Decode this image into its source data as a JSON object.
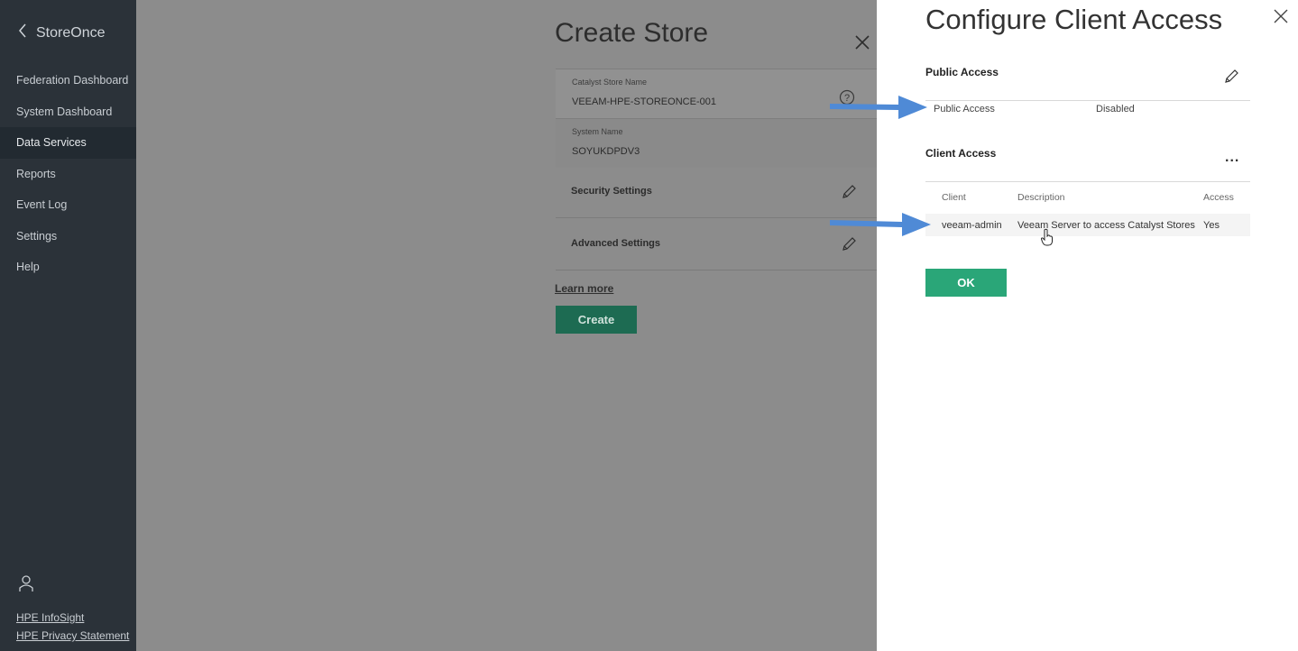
{
  "sidebar": {
    "brand": "StoreOnce",
    "items": [
      {
        "label": "Federation Dashboard"
      },
      {
        "label": "System Dashboard"
      },
      {
        "label": "Data Services"
      },
      {
        "label": "Reports"
      },
      {
        "label": "Event Log"
      },
      {
        "label": "Settings"
      },
      {
        "label": "Help"
      }
    ],
    "active_item": "Data Services",
    "footer_links": [
      "HPE InfoSight",
      "HPE Privacy Statement"
    ]
  },
  "create_store": {
    "title": "Create Store",
    "fields": [
      {
        "label": "Catalyst Store Name",
        "value": "VEEAM-HPE-STOREONCE-001"
      },
      {
        "label": "System Name",
        "value": "SOYUKDPDV3"
      }
    ],
    "settings": [
      "Security Settings",
      "Advanced Settings"
    ],
    "learn_more": "Learn more",
    "create_label": "Create"
  },
  "client_access": {
    "title": "Configure Client Access",
    "public_section": "Public Access",
    "public_row": {
      "label": "Public Access",
      "value": "Disabled"
    },
    "client_section": "Client Access",
    "columns": [
      "Client",
      "Description",
      "Access"
    ],
    "rows": [
      {
        "client": "veeam-admin",
        "description": "Veeam Server to access Catalyst Stores",
        "access": "Yes"
      }
    ],
    "more_label": "...",
    "ok_label": "OK"
  },
  "colors": {
    "sidebar_bg": "#2b3239",
    "ok_green": "#2aa678",
    "create_green": "#1d6b52",
    "arrow_blue": "#4f8ad6"
  }
}
